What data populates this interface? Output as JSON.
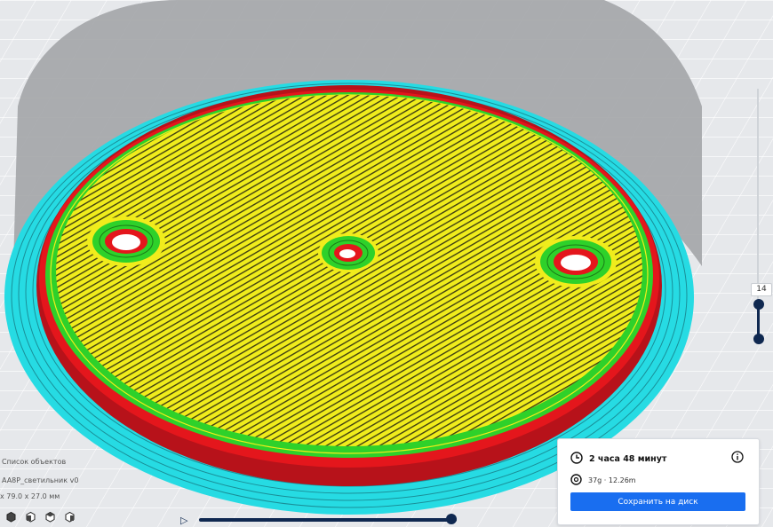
{
  "layer_slider": {
    "current_layer": "14"
  },
  "object_list": {
    "title": "Список объектов",
    "object_name": "AA8P_светильник v0",
    "dimensions": "x 79.0 x 27.0 мм"
  },
  "view_buttons": [
    "3d-view-icon",
    "front-view-icon",
    "top-view-icon",
    "side-view-icon"
  ],
  "print_info": {
    "time": "2 часа 48 минут",
    "material": "37g · 12.26m",
    "save_label": "Сохранить на диск"
  },
  "colors": {
    "infill": "#f0ec1c",
    "walls_inner": "#2ed12a",
    "walls_outer": "#e4161c",
    "skirt": "#26dbe3",
    "accent": "#196ef0",
    "slider": "#0f2850"
  }
}
